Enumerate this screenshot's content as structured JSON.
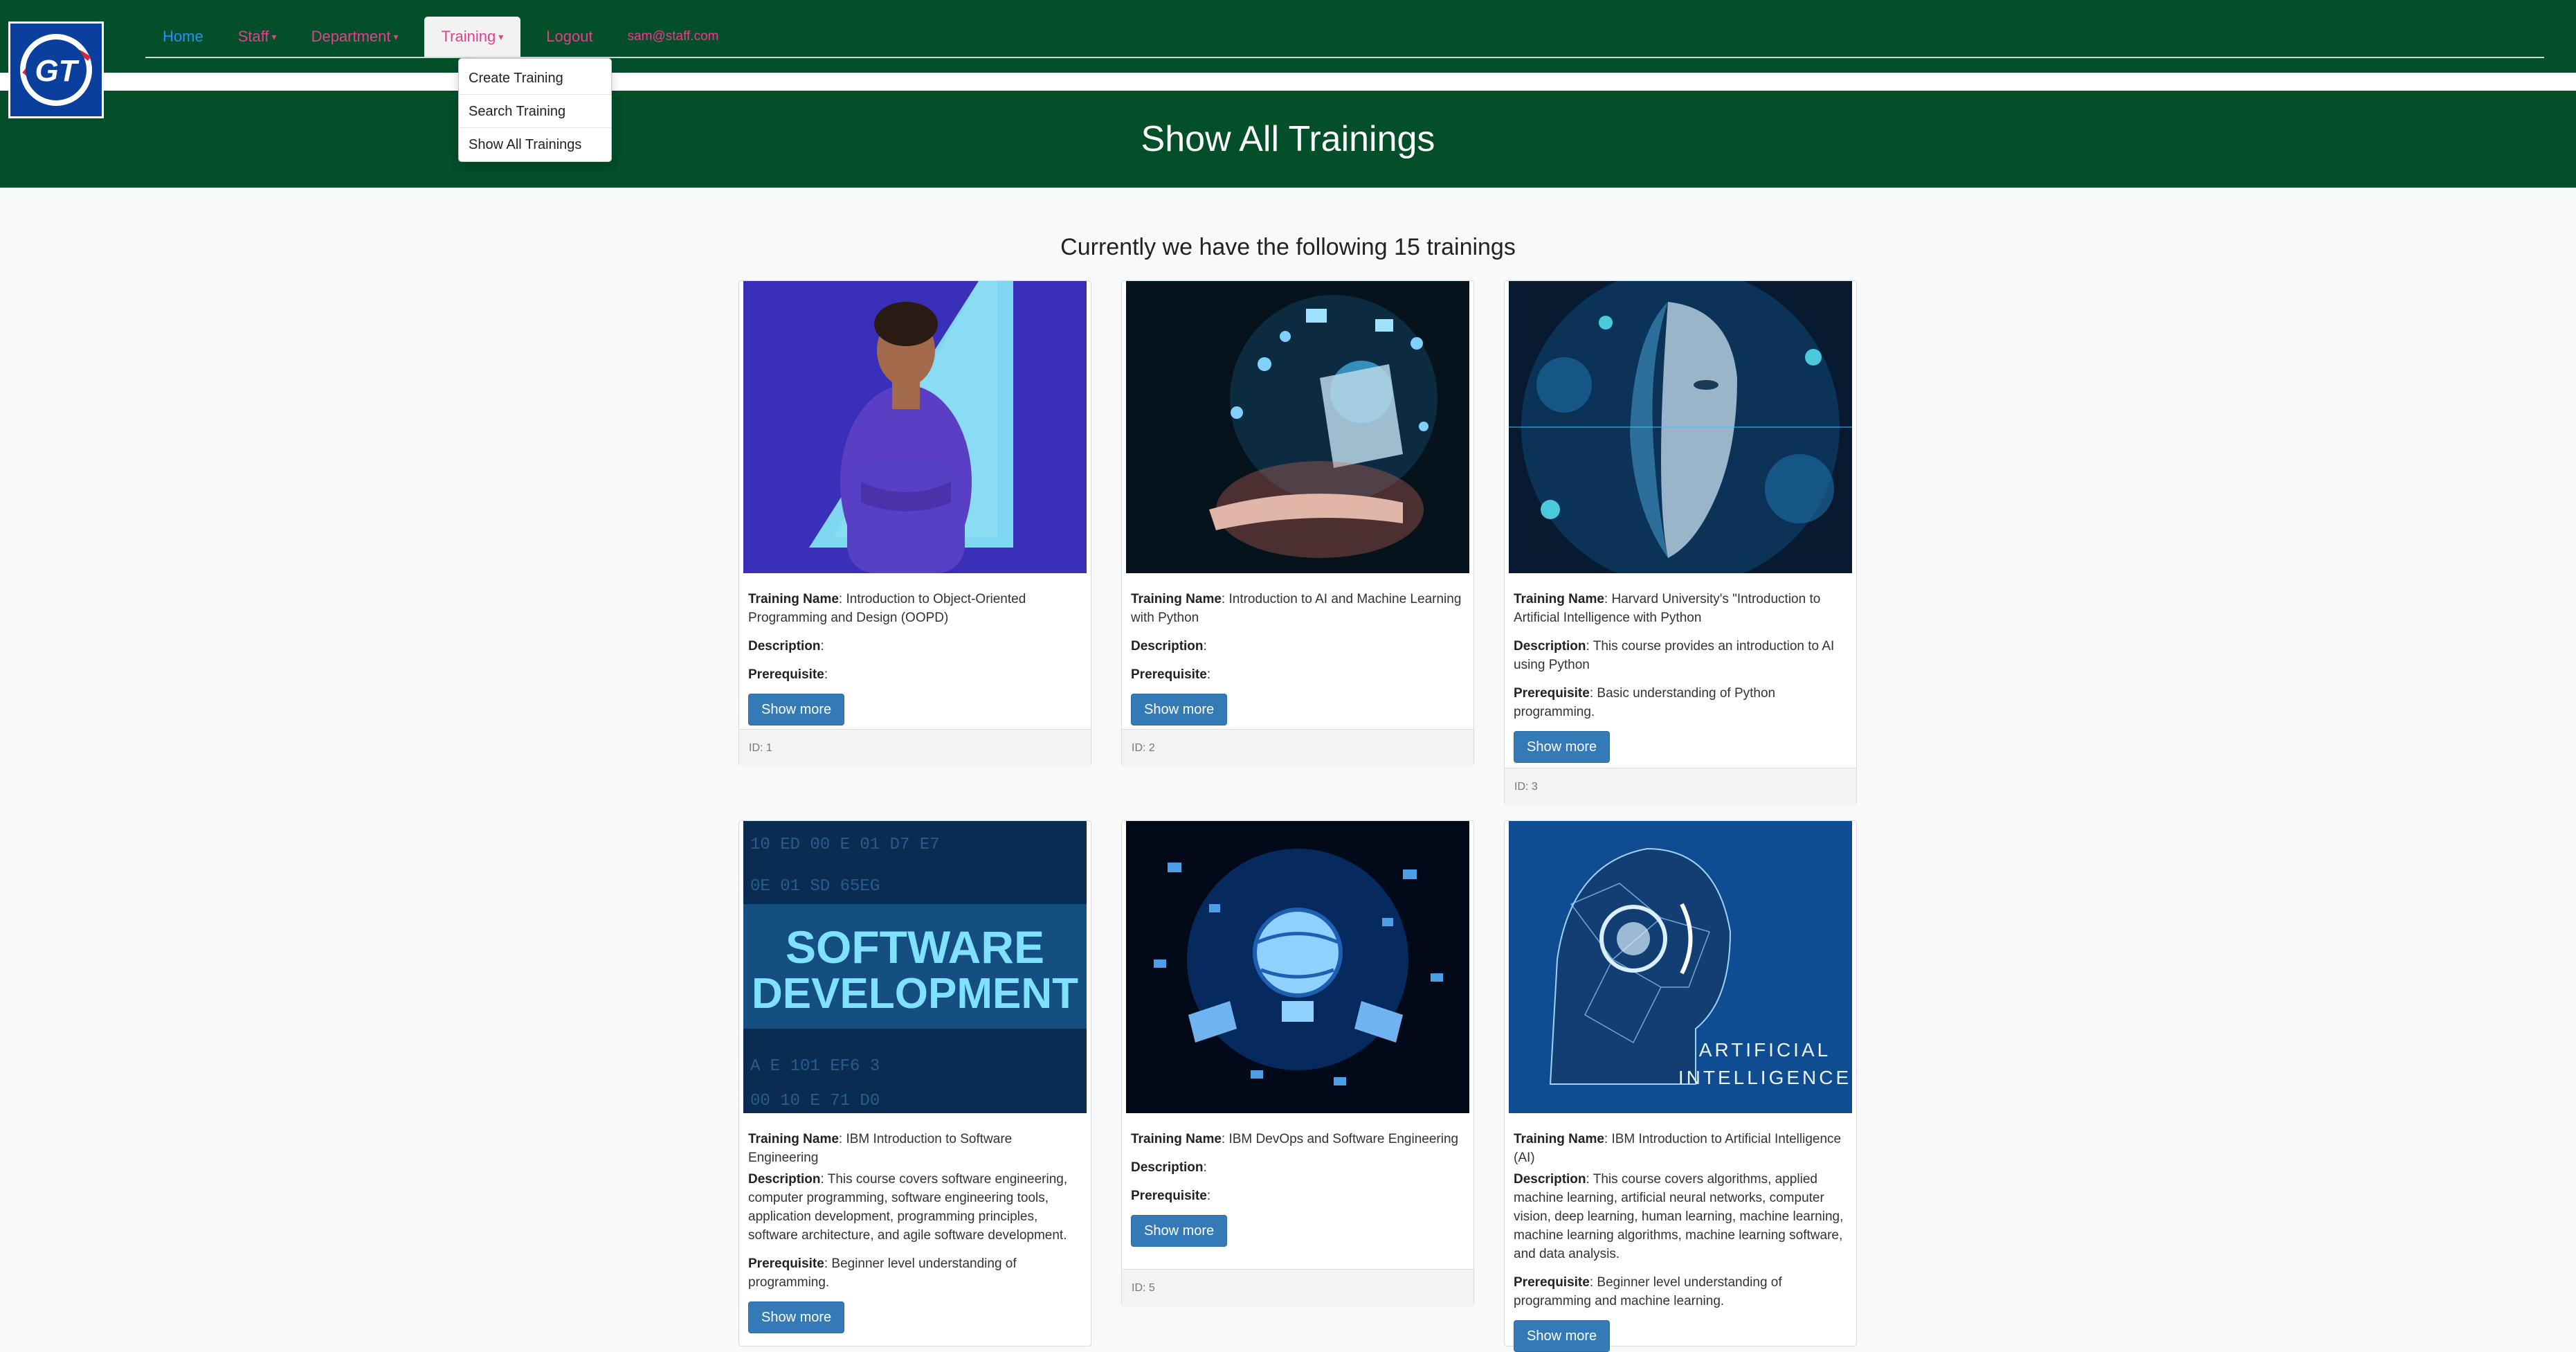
{
  "nav": {
    "logo_text": "GT",
    "home": "Home",
    "staff": "Staff",
    "department": "Department",
    "training": "Training",
    "logout": "Logout",
    "user_email": "sam@staff.com"
  },
  "dropdown": {
    "items": [
      "Create Training",
      "Search Training",
      "Show All Trainings"
    ]
  },
  "header": {
    "title": "Show All Trainings"
  },
  "subheading": "Currently we have the following 15 trainings",
  "labels": {
    "name": "Training Name",
    "description": "Description",
    "prerequisite": "Prerequisite",
    "show_more": "Show more"
  },
  "trainings": [
    {
      "name": "Introduction to Object-Oriented Programming and Design (OOPD)",
      "description": "",
      "prerequisite": "",
      "id": "ID: 1",
      "image": "woman-portrait"
    },
    {
      "name": "Introduction to AI and Machine Learning with Python",
      "description": "",
      "prerequisite": "",
      "id": "ID: 2",
      "image": "laptop-hand"
    },
    {
      "name": "Harvard University's \"Introduction to Artificial Intelligence with Python",
      "description": "This course provides an introduction to AI using Python",
      "prerequisite": "Basic understanding of Python programming.",
      "id": "ID: 3",
      "image": "cyber-face"
    },
    {
      "name": "IBM Introduction to Software Engineering",
      "description": "This course covers software engineering, computer programming, software engineering tools, application development, programming principles, software architecture, and agile software development.",
      "prerequisite": "Beginner level understanding of programming.",
      "id": "",
      "image": "software-development",
      "image_text": [
        "SOFTWARE",
        "DEVELOPMENT"
      ]
    },
    {
      "name": "IBM DevOps and Software Engineering",
      "description": "",
      "prerequisite": "",
      "id": "ID: 5",
      "image": "globe-network"
    },
    {
      "name": "IBM Introduction to Artificial Intelligence (AI)",
      "description": "This course covers algorithms, applied machine learning, artificial neural networks, computer vision, deep learning, human learning, machine learning, machine learning algorithms, machine learning software, and data analysis.",
      "prerequisite": "Beginner level understanding of programming and machine learning.",
      "id": "",
      "image": "ai-head",
      "image_text": [
        "ARTIFICIAL",
        "INTELLIGENCE"
      ]
    }
  ],
  "colors": {
    "navbar": "#024f2a",
    "link": "#e83e8c",
    "home_link": "#1e90ff",
    "button": "#337ab7"
  }
}
